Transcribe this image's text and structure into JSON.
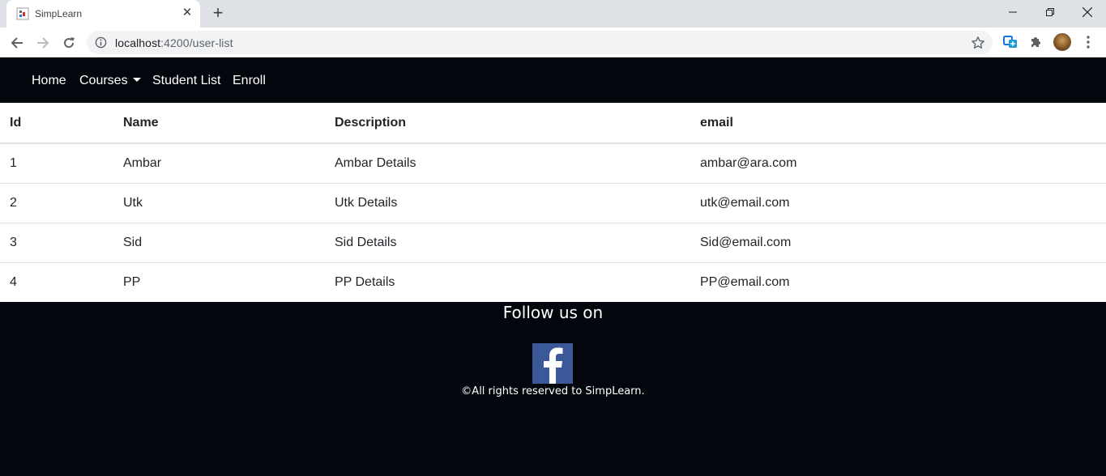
{
  "browser": {
    "tab_title": "SimpLearn",
    "tab_close": "✕",
    "new_tab": "+",
    "url_host": "localhost",
    "url_path": ":4200/user-list"
  },
  "navbar": {
    "home": "Home",
    "courses": "Courses",
    "student_list": "Student List",
    "enroll": "Enroll"
  },
  "table": {
    "headers": [
      "Id",
      "Name",
      "Description",
      "email"
    ],
    "rows": [
      [
        "1",
        "Ambar",
        "Ambar Details",
        "ambar@ara.com"
      ],
      [
        "2",
        "Utk",
        "Utk Details",
        "utk@email.com"
      ],
      [
        "3",
        "Sid",
        "Sid Details",
        "Sid@email.com"
      ],
      [
        "4",
        "PP",
        "PP Details",
        "PP@email.com"
      ]
    ]
  },
  "footer": {
    "follow": "Follow us on",
    "facebook_icon": "facebook-icon",
    "copyright": "©All rights reserved to SimpLearn."
  },
  "colors": {
    "page_bg": "#03060c",
    "facebook": "#3b5998",
    "table_border": "#dee2e6"
  }
}
